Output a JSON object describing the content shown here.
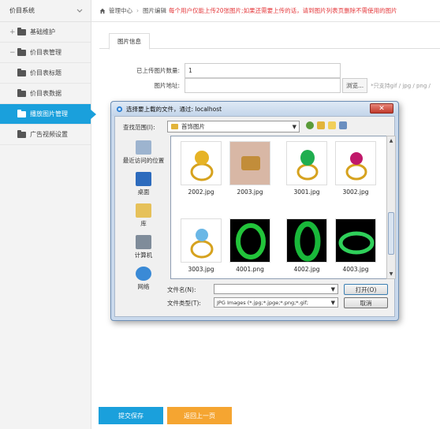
{
  "sidebar": {
    "title": "价目系统",
    "items": [
      {
        "label": "基础维护",
        "prefix": "+"
      },
      {
        "label": "价目表管理",
        "prefix": "−"
      },
      {
        "label": "价目表标题"
      },
      {
        "label": "价目表数据"
      },
      {
        "label": "播放图片管理"
      },
      {
        "label": "广告视频设置"
      }
    ]
  },
  "breadcrumb": {
    "items": [
      "管理中心",
      "图片编辑"
    ],
    "notice": "每个用户仅能上传20张图片;如果还需要上传的话，请到图片列表页删除不需使用的图片"
  },
  "tab": {
    "label": "图片信息"
  },
  "form": {
    "count_label": "已上传图片数量:",
    "count_value": "1",
    "addr_label": "图片地址:",
    "browse_label": "浏览...",
    "hint": "*只支持gif / jpg / png /"
  },
  "buttons": {
    "save": "提交保存",
    "back": "返回上一页"
  },
  "dialog": {
    "title": "选择要上载的文件，通过: localhost",
    "look_in_label": "查找范围(I):",
    "look_in_value": "首饰图片",
    "places": [
      "最近访问的位置",
      "桌面",
      "库",
      "计算机",
      "网络"
    ],
    "files": [
      "2002.jpg",
      "2003.jpg",
      "3001.jpg",
      "3002.jpg",
      "3003.jpg",
      "4001.png",
      "4002.jpg",
      "4003.jpg"
    ],
    "filename_label": "文件名(N):",
    "filename_value": "",
    "filetype_label": "文件类型(T):",
    "filetype_value": "JPG Images (*.jpg;*.jpge;*.png;*.gif;",
    "open_label": "打开(O)",
    "cancel_label": "取消"
  },
  "colors": {
    "accent": "#1aa0dc",
    "back_button": "#f5a531",
    "notice": "#e4393c"
  }
}
